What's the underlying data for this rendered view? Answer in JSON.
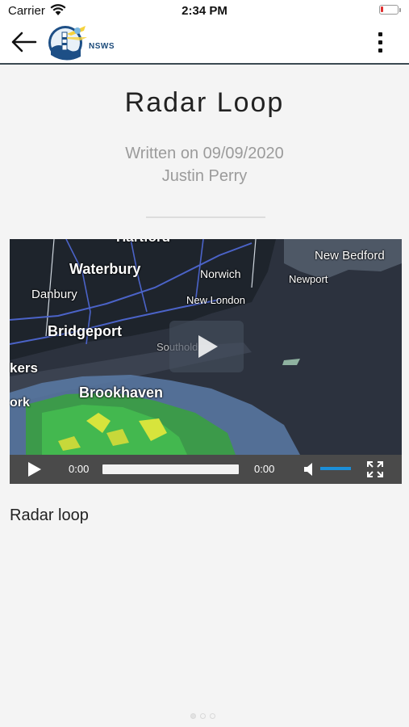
{
  "status_bar": {
    "carrier": "Carrier",
    "time": "2:34 PM",
    "battery_color": "#e03030"
  },
  "nav": {
    "back_icon": "arrow-left-icon",
    "logo_text": "NSWS",
    "menu_icon": "more-vertical-icon"
  },
  "article": {
    "title": "Radar Loop",
    "date": "Written on 09/09/2020",
    "author": "Justin Perry",
    "caption": "Radar loop"
  },
  "video": {
    "map_labels": {
      "hartford": "Hartford",
      "waterbury": "Waterbury",
      "norwich": "Norwich",
      "new_bedford": "New Bedford",
      "newport": "Newport",
      "danbury": "Danbury",
      "new_london": "New London",
      "bridgeport": "Bridgeport",
      "southold": "Southold",
      "kers": "kers",
      "brookhaven": "Brookhaven",
      "ork": "ork"
    },
    "current_time": "0:00",
    "duration": "0:00",
    "accent_color": "#1c8fd8"
  },
  "pagination": {
    "pages": 3,
    "current": 1
  }
}
